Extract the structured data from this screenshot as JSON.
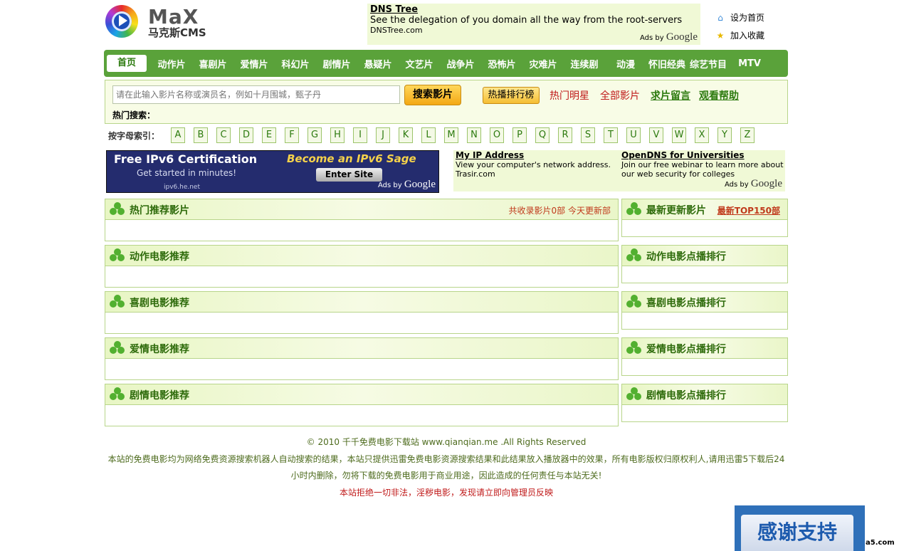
{
  "logo": {
    "brand": "MaX",
    "sub": "马克斯CMS"
  },
  "top_ad": {
    "title": "DNS Tree",
    "desc": "See the delegation of you domain all the way from the root-servers",
    "url": "DNSTree.com",
    "adsby": "Ads by",
    "google": "Google"
  },
  "top_links": {
    "set_home": "设为首页",
    "add_fav": "加入收藏"
  },
  "nav": [
    "首页",
    "动作片",
    "喜剧片",
    "爱情片",
    "科幻片",
    "剧情片",
    "悬疑片",
    "文艺片",
    "战争片",
    "恐怖片",
    "灾难片",
    "连续剧",
    "动漫",
    "怀旧经典",
    "综艺节目",
    "MTV"
  ],
  "search": {
    "placeholder": "请在此输入影片名称或演员名，例如十月围城，甄子丹",
    "button": "搜索影片",
    "rank": "热播排行榜",
    "hot_stars": "热门明星",
    "all_movies": "全部影片",
    "request": "求片留言",
    "help": "观看帮助",
    "hot_label": "热门搜索："
  },
  "letters": {
    "label": "按字母索引：",
    "items": [
      "A",
      "B",
      "C",
      "D",
      "E",
      "F",
      "G",
      "H",
      "I",
      "J",
      "K",
      "L",
      "M",
      "N",
      "O",
      "P",
      "Q",
      "R",
      "S",
      "T",
      "U",
      "V",
      "W",
      "X",
      "Y",
      "Z"
    ]
  },
  "ipv6": {
    "headline": "Free IPv6 Certification",
    "sub": "Get started in minutes!",
    "sage": "Become an IPv6 Sage",
    "enter": "Enter Site",
    "url": "ipv6.he.net",
    "adsby": "Ads by",
    "google": "Google"
  },
  "text_ads": [
    {
      "title": "My IP Address",
      "desc": "View your computer's network address.",
      "url": "Trasir.com"
    },
    {
      "title": "OpenDNS for Universities",
      "desc": "Join our free webinar to learn more about our web security for colleges"
    }
  ],
  "text_ads_footer": {
    "adsby": "Ads by",
    "google": "Google"
  },
  "left_panels": [
    {
      "title": "热门推荐影片",
      "meta": "共收录影片0部   今天更新部"
    },
    {
      "title": "动作电影推荐"
    },
    {
      "title": "喜剧电影推荐"
    },
    {
      "title": "爱情电影推荐"
    },
    {
      "title": "剧情电影推荐"
    }
  ],
  "right_panels": [
    {
      "title": "最新更新影片",
      "link": "最新TOP150部"
    },
    {
      "title": "动作电影点播排行"
    },
    {
      "title": "喜剧电影点播排行"
    },
    {
      "title": "爱情电影点播排行"
    },
    {
      "title": "剧情电影点播排行"
    }
  ],
  "footer": {
    "copyright": "© 2010 千千免费电影下载站 www.qianqian.me .All Rights Reserved",
    "line1": "本站的免费电影均为网络免费资源搜索机器人自动搜索的结果，本站只提供迅雷免费电影资源搜索结果和此结果放入播放器中的效果，所有电影版权归原权利人,请用迅雷5下载后24",
    "line2": "小时内删除，勿将下载的免费电影用于商业用途，因此造成的任何责任与本站无关!",
    "warning": "本站拒绝一切非法，淫秽电影，发现请立即向管理员反映"
  },
  "thanks": "感谢支持",
  "watermark": "a5.com"
}
